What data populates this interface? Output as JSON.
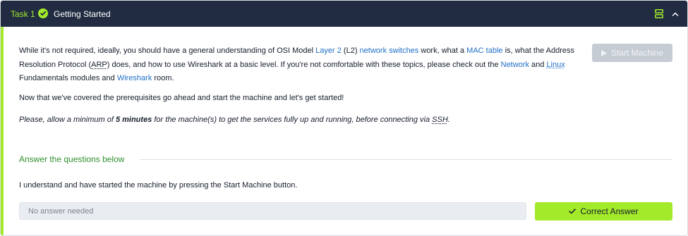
{
  "task": {
    "label": "Task 1",
    "title": "Getting Started"
  },
  "intro": {
    "t1": "While it's not required, ideally, you should have a general understanding of OSI Model ",
    "link_layer2": "Layer 2",
    "t2": " (L2) ",
    "link_switches": "network switches",
    "t3": " work, what a ",
    "link_mac": "MAC table",
    "t4": " is, what the Address Resolution Protocol (",
    "abbr_arp": "ARP",
    "t5": ") does, and how to use Wireshark at a basic level. If you're not comfortable with these topics, please check out the ",
    "link_network": "Network",
    "t6": " and ",
    "link_linux": "Linux",
    "t7": " Fundamentals modules and ",
    "link_wireshark": "Wireshark",
    "t8": " room."
  },
  "para2": "Now that we've covered the prerequisites go ahead and start the machine and let's get started!",
  "para3": {
    "t1": "Please, allow a minimum of ",
    "bold": "5 minutes",
    "t2": " for the machine(s) to get the services fully up and running, before connecting via ",
    "abbr_ssh": "SSH",
    "t3": "."
  },
  "start_button": "Start Machine",
  "answer_section": {
    "heading": "Answer the questions below",
    "question": "I understand and have started the machine by pressing the Start Machine button.",
    "placeholder": "No answer needed",
    "submit": "Correct Answer"
  },
  "colors": {
    "header_bg": "#212c42",
    "accent_green": "#a3ea2a",
    "link": "#1f6fc7",
    "heading_green": "#2f8f2f"
  },
  "icons": {
    "completed": "check-circle-icon",
    "layout": "split-view-icon",
    "collapse": "chevron-up-icon",
    "play": "play-icon",
    "submit_check": "check-icon"
  }
}
